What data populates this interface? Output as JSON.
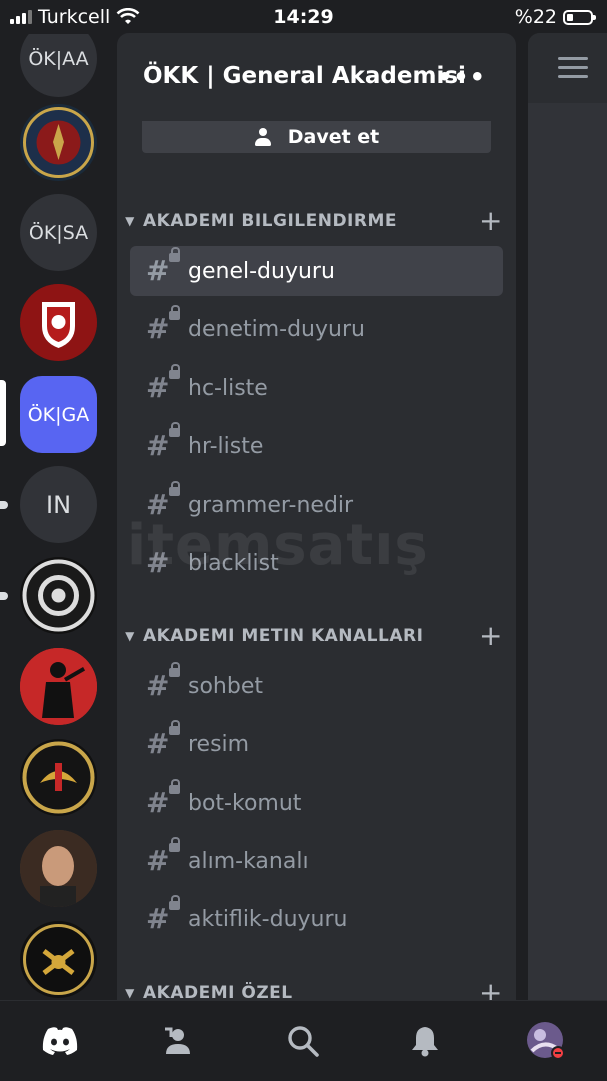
{
  "status_bar": {
    "carrier": "Turkcell",
    "time": "14:29",
    "battery": "%22"
  },
  "servers": [
    "ÖK|AA",
    "",
    "ÖK|SA",
    "",
    "ÖK|GA",
    "IN",
    "",
    "",
    "",
    "",
    ""
  ],
  "guild": {
    "name": "ÖKK | General Akademisi",
    "more": "•••",
    "invite_label": "Davet et"
  },
  "categories": [
    {
      "name": "AKADEMI BILGILENDIRME",
      "add": "+"
    },
    {
      "name": "AKADEMI METIN KANALLARI",
      "add": "+"
    },
    {
      "name": "AKADEMI ÖZEL",
      "add": "+"
    }
  ],
  "channels_info": [
    "genel-duyuru",
    "denetim-duyuru",
    "hc-liste",
    "hr-liste",
    "grammer-nedir",
    "blacklist"
  ],
  "channels_text": [
    "sohbet",
    "resim",
    "bot-komut",
    "alım-kanalı",
    "aktiflik-duyuru"
  ],
  "watermark": "itemsatış"
}
